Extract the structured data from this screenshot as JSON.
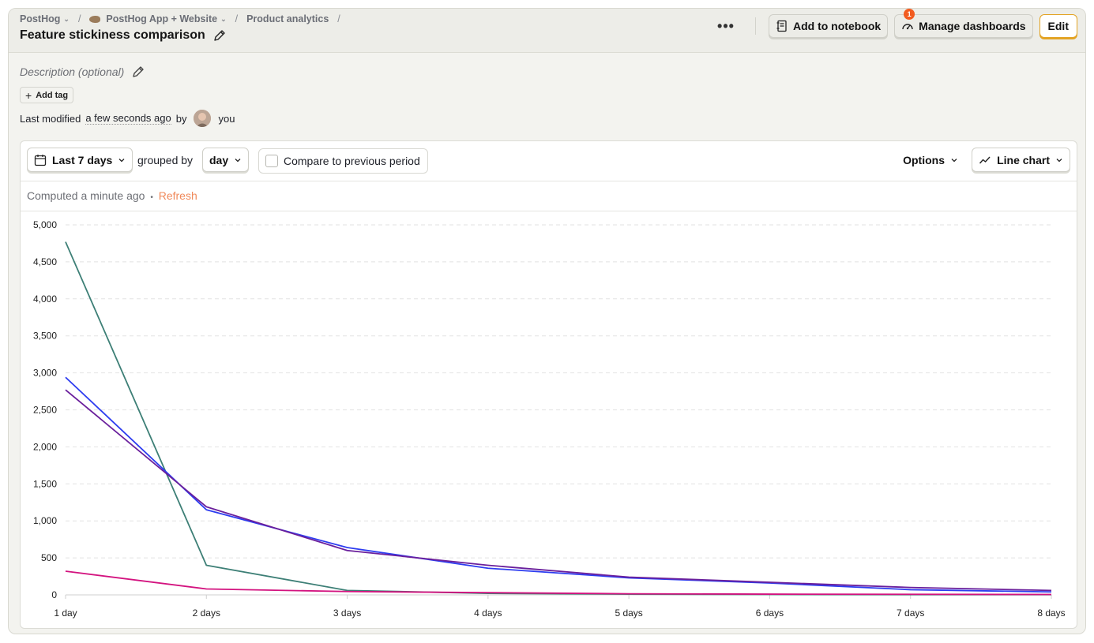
{
  "breadcrumbs": [
    {
      "label": "PostHog"
    },
    {
      "label": "PostHog App + Website"
    },
    {
      "label": "Product analytics"
    }
  ],
  "title": "Feature stickiness comparison",
  "actions": {
    "more_label": "•••",
    "add_notebook": "Add to notebook",
    "manage_dashboards": "Manage dashboards",
    "dashboards_badge": "1",
    "edit": "Edit"
  },
  "description_placeholder": "Description (optional)",
  "add_tag": "Add tag",
  "modified": {
    "prefix": "Last modified",
    "when": "a few seconds ago",
    "by": "by",
    "user": "you"
  },
  "toolbar": {
    "date_range": "Last 7 days",
    "grouped_by_label": "grouped by",
    "interval": "day",
    "compare_label": "Compare to previous period",
    "options_label": "Options",
    "chart_type_label": "Line chart"
  },
  "status": {
    "computed": "Computed a minute ago",
    "separator": "•",
    "refresh": "Refresh"
  },
  "colors": {
    "accent": "#f0895a",
    "edit_border": "#e3a323",
    "badge": "#f25b1f"
  },
  "chart_data": {
    "type": "line",
    "x": [
      "1 day",
      "2 days",
      "3 days",
      "4 days",
      "5 days",
      "6 days",
      "7 days",
      "8 days"
    ],
    "ylim": [
      0,
      5000
    ],
    "yticks": [
      0,
      500,
      1000,
      1500,
      2000,
      2500,
      3000,
      3500,
      4000,
      4500,
      5000
    ],
    "ytick_labels": [
      "0",
      "500",
      "1,000",
      "1,500",
      "2,000",
      "2,500",
      "3,000",
      "3,500",
      "4,000",
      "4,500",
      "5,000"
    ],
    "grid": true,
    "series": [
      {
        "color": "#3d7f76",
        "values": [
          4770,
          400,
          60,
          20,
          10,
          5,
          3,
          3
        ]
      },
      {
        "color": "#2d3cf0",
        "values": [
          2940,
          1150,
          640,
          360,
          230,
          160,
          70,
          40
        ]
      },
      {
        "color": "#6a1f9c",
        "values": [
          2770,
          1190,
          600,
          400,
          240,
          170,
          100,
          60
        ]
      },
      {
        "color": "#d3137f",
        "values": [
          320,
          80,
          45,
          30,
          15,
          10,
          8,
          5
        ]
      }
    ]
  }
}
